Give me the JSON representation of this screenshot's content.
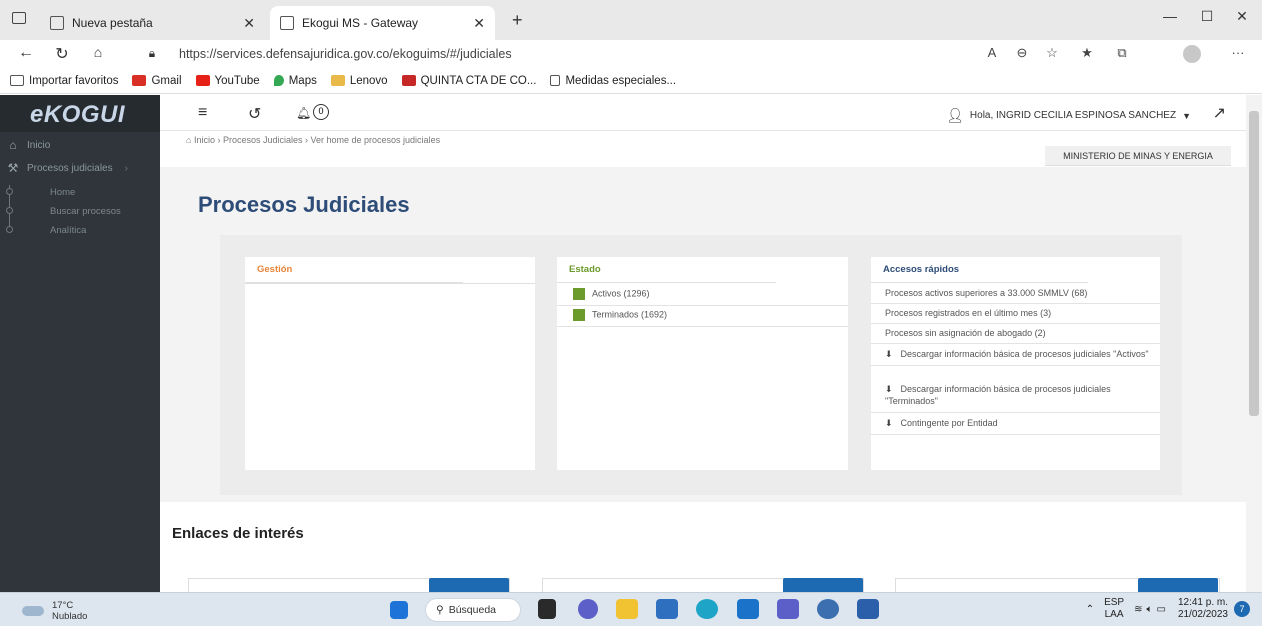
{
  "browser": {
    "tabs": [
      {
        "label": "Nueva pestaña"
      },
      {
        "label": "Ekogui MS - Gateway"
      }
    ],
    "url": "https://services.defensajuridica.gov.co/ekoguims/#/judiciales",
    "favorites": [
      {
        "label": "Importar favoritos",
        "icon": "import-icon"
      },
      {
        "label": "Gmail",
        "icon": "gmail-icon"
      },
      {
        "label": "YouTube",
        "icon": "youtube-icon"
      },
      {
        "label": "Maps",
        "icon": "maps-icon"
      },
      {
        "label": "Lenovo",
        "icon": "folder-icon"
      },
      {
        "label": "QUINTA CTA DE CO...",
        "icon": "pdf-icon"
      },
      {
        "label": "Medidas especiales...",
        "icon": "page-icon"
      }
    ]
  },
  "app": {
    "logo_text": "eKOGUI",
    "sidebar": {
      "items": [
        {
          "label": "Inicio",
          "icon": "home-icon"
        },
        {
          "label": "Procesos judiciales",
          "icon": "gavel-icon"
        }
      ],
      "subitems": [
        "Home",
        "Buscar procesos",
        "Analítica"
      ]
    },
    "topbar": {
      "notif_count": "0",
      "user_greeting": "Hola, INGRID CECILIA ESPINOSA SANCHEZ"
    },
    "breadcrumb": "Inicio › Procesos Judiciales › Ver home de procesos judiciales",
    "entity": "MINISTERIO DE MINAS Y ENERGIA",
    "page_title": "Procesos Judiciales",
    "panels": {
      "gestion": {
        "title": "Gestión",
        "color": "#e8853b"
      },
      "estado": {
        "title": "Estado",
        "color": "#6c9a2b",
        "rows": [
          "Activos (1296)",
          "Terminados (1692)"
        ]
      },
      "accesos": {
        "title": "Accesos rápidos",
        "color": "#2d4c78",
        "rows": [
          "Procesos activos superiores a 33.000 SMMLV (68)",
          "Procesos registrados en el último mes (3)",
          "Procesos sin asignación de abogado (2)"
        ],
        "download_rows": [
          "Descargar información básica de procesos judiciales \"Activos\"",
          "Descargar información básica de procesos judiciales \"Terminados\"",
          "Contingente por Entidad"
        ]
      }
    },
    "links_title": "Enlaces de interés"
  },
  "taskbar": {
    "weather_temp": "17°C",
    "weather_desc": "Nublado",
    "search_label": "Búsqueda",
    "lang_top": "ESP",
    "lang_bottom": "LAA",
    "time": "12:41 p. m.",
    "date": "21/02/2023",
    "notif_count": "7"
  }
}
